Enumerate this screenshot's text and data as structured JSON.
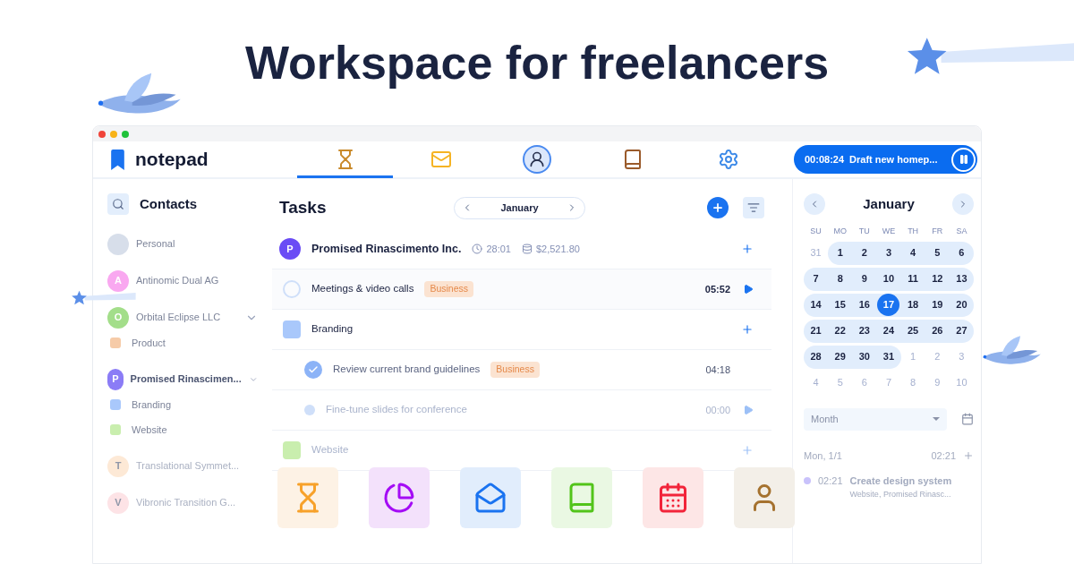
{
  "headline": "Workspace for freelancers",
  "app": {
    "logo": "notepad",
    "nav_tabs": [
      {
        "selected": true
      },
      {
        "selected": false
      },
      {
        "selected": false
      },
      {
        "selected": false
      },
      {
        "selected": false
      }
    ],
    "timer": {
      "time": "00:08:24",
      "task": "Draft new homep...",
      "running": true
    }
  },
  "contacts": {
    "title": "Contacts",
    "items": [
      {
        "kind": "person",
        "label": "Personal",
        "faded": false
      },
      {
        "kind": "company",
        "letter": "A",
        "label": "Antinomic Dual AG",
        "color": "#f9a8f0",
        "faded": false
      },
      {
        "kind": "company",
        "letter": "O",
        "label": "Orbital Eclipse LLC",
        "color": "#a3de8a",
        "faded": false,
        "expanded": true,
        "children": [
          {
            "label": "Product",
            "color": "#f6cba8"
          }
        ]
      },
      {
        "kind": "company",
        "letter": "P",
        "label": "Promised Rinascimen...",
        "color": "#8b7cf6",
        "faded": false,
        "expanded": true,
        "children": [
          {
            "label": "Branding",
            "color": "#a9c8fb"
          },
          {
            "label": "Website",
            "color": "#c9eeae"
          }
        ]
      },
      {
        "kind": "company",
        "letter": "T",
        "label": "Translational Symmet...",
        "color": "#fde9d6",
        "faded": true
      },
      {
        "kind": "company",
        "letter": "V",
        "label": "Vibronic Transition G...",
        "color": "#fde3e6",
        "faded": true
      }
    ]
  },
  "tasks": {
    "title": "Tasks",
    "month": "January",
    "rows": [
      {
        "kind": "project",
        "letter": "P",
        "color": "#6a4cf5",
        "name": "Promised Rinascimento Inc.",
        "time": "28:01",
        "amount": "$2,521.80",
        "faded": false
      },
      {
        "kind": "task",
        "name": "Meetings & video calls",
        "tag": "Business",
        "time": "05:52",
        "checked": false,
        "faded": false
      },
      {
        "kind": "group",
        "name": "Branding",
        "color": "#a9c8fb",
        "faded": false
      },
      {
        "kind": "subtask",
        "name": "Review current brand guidelines",
        "tag": "Business",
        "time": "04:18",
        "checked": true,
        "faded": false
      },
      {
        "kind": "subtask",
        "name": "Fine-tune slides for conference",
        "time": "00:00",
        "checked": false,
        "faded": true
      },
      {
        "kind": "group",
        "name": "Website",
        "color": "#c9eeae",
        "faded": true
      }
    ]
  },
  "calendar": {
    "month": "January",
    "weekdays": [
      "SU",
      "MO",
      "TU",
      "WE",
      "TH",
      "FR",
      "SA"
    ],
    "weeks": [
      [
        {
          "day": "31",
          "current": false,
          "selected": false
        },
        {
          "day": "1",
          "current": true,
          "selected": false
        },
        {
          "day": "2",
          "current": true,
          "selected": false
        },
        {
          "day": "3",
          "current": true,
          "selected": false
        },
        {
          "day": "4",
          "current": true,
          "selected": false
        },
        {
          "day": "5",
          "current": true,
          "selected": false
        },
        {
          "day": "6",
          "current": true,
          "selected": false
        }
      ],
      [
        {
          "day": "7",
          "current": true,
          "selected": false
        },
        {
          "day": "8",
          "current": true,
          "selected": false
        },
        {
          "day": "9",
          "current": true,
          "selected": false
        },
        {
          "day": "10",
          "current": true,
          "selected": false
        },
        {
          "day": "11",
          "current": true,
          "selected": false
        },
        {
          "day": "12",
          "current": true,
          "selected": false
        },
        {
          "day": "13",
          "current": true,
          "selected": false
        }
      ],
      [
        {
          "day": "14",
          "current": true,
          "selected": false
        },
        {
          "day": "15",
          "current": true,
          "selected": false
        },
        {
          "day": "16",
          "current": true,
          "selected": false
        },
        {
          "day": "17",
          "current": true,
          "selected": true
        },
        {
          "day": "18",
          "current": true,
          "selected": false
        },
        {
          "day": "19",
          "current": true,
          "selected": false
        },
        {
          "day": "20",
          "current": true,
          "selected": false
        }
      ],
      [
        {
          "day": "21",
          "current": true,
          "selected": false
        },
        {
          "day": "22",
          "current": true,
          "selected": false
        },
        {
          "day": "23",
          "current": true,
          "selected": false
        },
        {
          "day": "24",
          "current": true,
          "selected": false
        },
        {
          "day": "25",
          "current": true,
          "selected": false
        },
        {
          "day": "26",
          "current": true,
          "selected": false
        },
        {
          "day": "27",
          "current": true,
          "selected": false
        }
      ],
      [
        {
          "day": "28",
          "current": true,
          "selected": false
        },
        {
          "day": "29",
          "current": true,
          "selected": false
        },
        {
          "day": "30",
          "current": true,
          "selected": false
        },
        {
          "day": "31",
          "current": true,
          "selected": false
        },
        {
          "day": "1",
          "current": false,
          "selected": false
        },
        {
          "day": "2",
          "current": false,
          "selected": false
        },
        {
          "day": "3",
          "current": false,
          "selected": false
        }
      ],
      [
        {
          "day": "4",
          "current": false,
          "selected": false
        },
        {
          "day": "5",
          "current": false,
          "selected": false
        },
        {
          "day": "6",
          "current": false,
          "selected": false
        },
        {
          "day": "7",
          "current": false,
          "selected": false
        },
        {
          "day": "8",
          "current": false,
          "selected": false
        },
        {
          "day": "9",
          "current": false,
          "selected": false
        },
        {
          "day": "10",
          "current": false,
          "selected": false
        }
      ]
    ],
    "view": "Month",
    "agenda": {
      "date": "Mon, 1/1",
      "total": "02:21",
      "events": [
        {
          "time": "02:21",
          "title": "Create design system",
          "subtitle": "Website, Promised Rinasc..."
        }
      ]
    }
  }
}
